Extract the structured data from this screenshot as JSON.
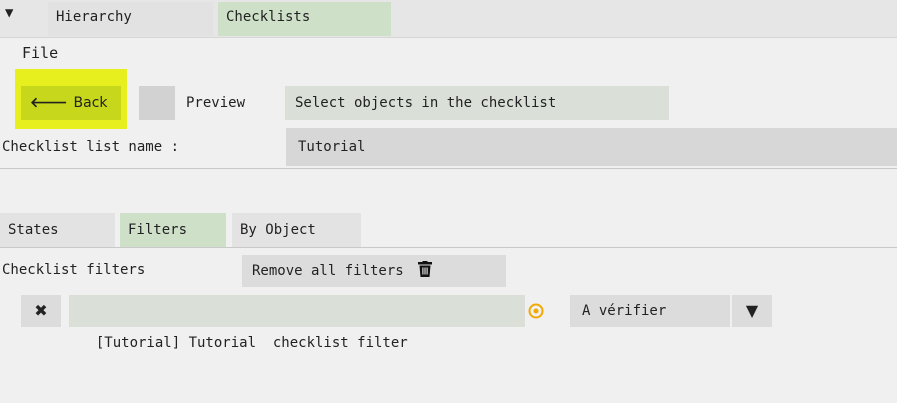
{
  "top_tabs": [
    {
      "label": "Hierarchy"
    },
    {
      "label": "Checklists"
    }
  ],
  "menu": {
    "file_label": "File"
  },
  "toolbar": {
    "back_label": "Back",
    "preview_label": "Preview",
    "select_objects_label": "Select objects in the checklist"
  },
  "checklist": {
    "name_label": "Checklist list name :",
    "name_value": "Tutorial"
  },
  "sub_tabs": [
    {
      "label": "States"
    },
    {
      "label": "Filters"
    },
    {
      "label": "By Object"
    }
  ],
  "filters": {
    "section_label": "Checklist filters",
    "remove_all_label": "Remove all filters",
    "items": [
      {
        "name": "[Tutorial] Tutorial  checklist filter",
        "state": "A vérifier"
      }
    ]
  },
  "colors": {
    "highlight": "#e8ef1e",
    "back_button": "#c7d71b",
    "active_tab": "#cfe0c9",
    "state_icon": "#f2a900"
  },
  "icons": {
    "collapse": "triangle-down-icon",
    "back": "arrow-left-icon",
    "remove_all": "trash-icon",
    "remove_filter": "close-icon",
    "state": "target-circle-icon",
    "dropdown": "triangle-down-icon"
  }
}
